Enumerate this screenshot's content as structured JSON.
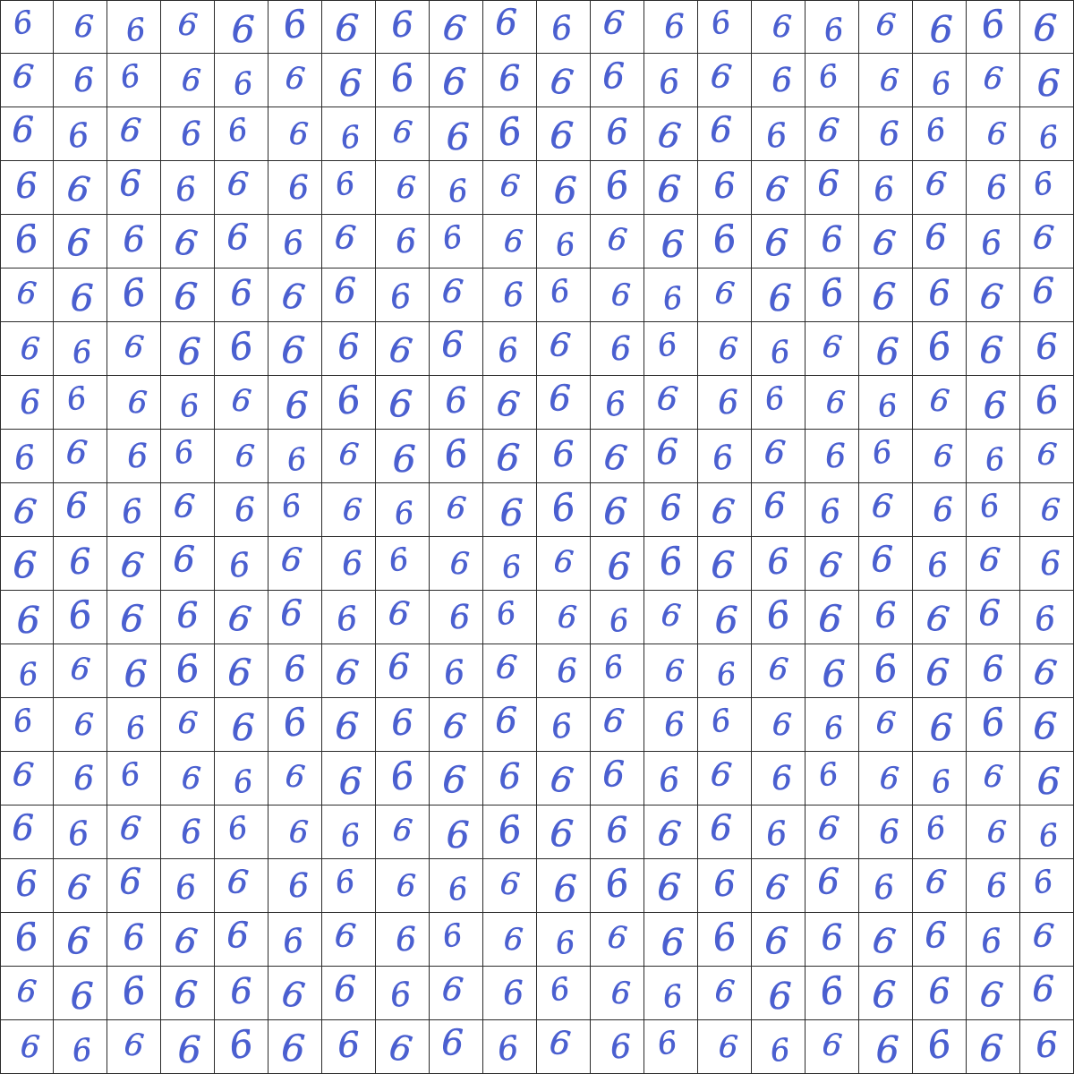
{
  "sheet": {
    "rows": 20,
    "columns": 20,
    "digit": "6",
    "ink_color": "#4a5fd0",
    "grid_line_color": "#2b2b2b",
    "background_color": "#ffffff"
  }
}
